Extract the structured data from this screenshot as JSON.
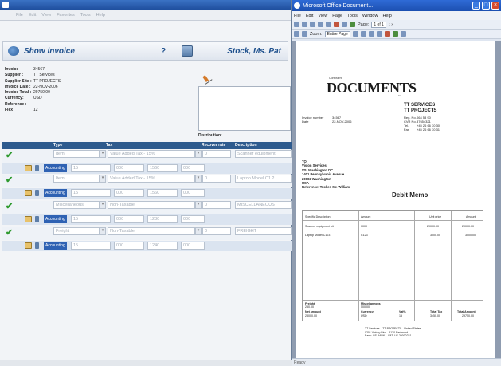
{
  "left": {
    "menu": [
      "File",
      "Edit",
      "View",
      "Favorites",
      "Tools",
      "Help"
    ],
    "header": {
      "title": "Show invoice",
      "help": "?",
      "user": "Stock, Ms. Pat"
    },
    "info": [
      {
        "k": "Invoice",
        "v": "34567"
      },
      {
        "k": "Supplier :",
        "v": "TT Services"
      },
      {
        "k": "Supplier Site :",
        "v": "TT PROJECTS"
      },
      {
        "k": "Invoice Date :",
        "v": "22-NOV-2006"
      },
      {
        "k": "Invoice Total :",
        "v": "29750.00"
      },
      {
        "k": "Currency:",
        "v": "USD"
      },
      {
        "k": "Reference :",
        "v": ""
      },
      {
        "k": "Flex",
        "v": "12"
      }
    ],
    "distribution_label": "Distribution:",
    "grid_headers": {
      "type": "Type",
      "tax": "Tax",
      "recover": "Recover rate",
      "desc": "Description"
    },
    "lines": [
      {
        "type": "Item",
        "tax": "Value Added Tax - 15%",
        "rate": "0",
        "desc": "Scanner equipment",
        "acct": "Accounting",
        "n1": "15",
        "n2": "000",
        "n3": "1560",
        "n4": "000"
      },
      {
        "type": "Item",
        "tax": "Value Added Tax - 15%",
        "rate": "0",
        "desc": "Laptop Model C1 2",
        "acct": "Accounting",
        "n1": "15",
        "n2": "000",
        "n3": "1560",
        "n4": "000"
      },
      {
        "type": "Miscellaneous",
        "tax": "Non-Taxable",
        "rate": "0",
        "desc": "MISCELLANEOUS",
        "acct": "Accounting",
        "n1": "15",
        "n2": "000",
        "n3": "1230",
        "n4": "000"
      },
      {
        "type": "Freight",
        "tax": "Non-Taxable",
        "rate": "0",
        "desc": "FREIGHT",
        "acct": "Accounting",
        "n1": "15",
        "n2": "000",
        "n3": "1240",
        "n4": "000"
      }
    ]
  },
  "right": {
    "title": "Microsoft Office Document...",
    "menu": [
      "File",
      "Edit",
      "View",
      "Page",
      "Tools",
      "Window",
      "Help"
    ],
    "page_label": "Page:",
    "page_value": "1 of 1",
    "zoom_label": "Zoom:",
    "zoom_value": "Entire Page",
    "status": "Ready",
    "doc": {
      "logo_small": "Consistent",
      "logo": "DOCUMENTS",
      "logo_inc": "Inc.",
      "company1": "TT SERVICES",
      "company2": "TT PROJECTS",
      "reg": [
        {
          "k": "Reg. No.",
          "v": "064 58 90"
        },
        {
          "k": "CVR No.",
          "v": "87654321"
        },
        {
          "k": "Tel.",
          "v": "+45 26 66 30 30"
        },
        {
          "k": "Fax",
          "v": "+45 26 66 30 31"
        }
      ],
      "inv": [
        {
          "k": "Invoice number",
          "v": "34567"
        },
        {
          "k": "Date",
          "v": "22-NOV-2006"
        }
      ],
      "to": [
        "TO:",
        "Vision Services",
        "VS- Washington DC",
        "1401 Pennsylvania Avenue",
        "20002 Washington",
        "USA",
        "Reference: Tucker, Mr. William"
      ],
      "debit": "Debit Memo",
      "table_headers": [
        "Specific Description",
        "Amount",
        "",
        "Unit price",
        "Amount"
      ],
      "rows": [
        {
          "desc": "Scanner equipment kit",
          "qty": "0000",
          "unit": "20000.00",
          "amt": "20000.00"
        },
        {
          "desc": "Laptop Model C123",
          "qty": "C123",
          "unit": "3000.00",
          "amt": "3000.00"
        }
      ],
      "totals": {
        "freight_label": "Freight",
        "freight_val": "250.00",
        "misc_label": "Miscellaneous",
        "misc_val": "500.00",
        "net_label": "Net amount",
        "net_val": "23000.00",
        "cur_label": "Currency",
        "cur_val": "USD",
        "vat_label": "Vat%",
        "vat_val": "15",
        "total_tax_label": "Total Tax",
        "total_tax_val": "3450.00",
        "total_label": "Total Amount",
        "total_val": "29750.00"
      },
      "footer": [
        "TT Services – TT PROJECTS - United States",
        "0201 Victory Bivd - 4130 Redmond",
        "Bank: US BANK – VAT: US 20000231"
      ]
    }
  }
}
